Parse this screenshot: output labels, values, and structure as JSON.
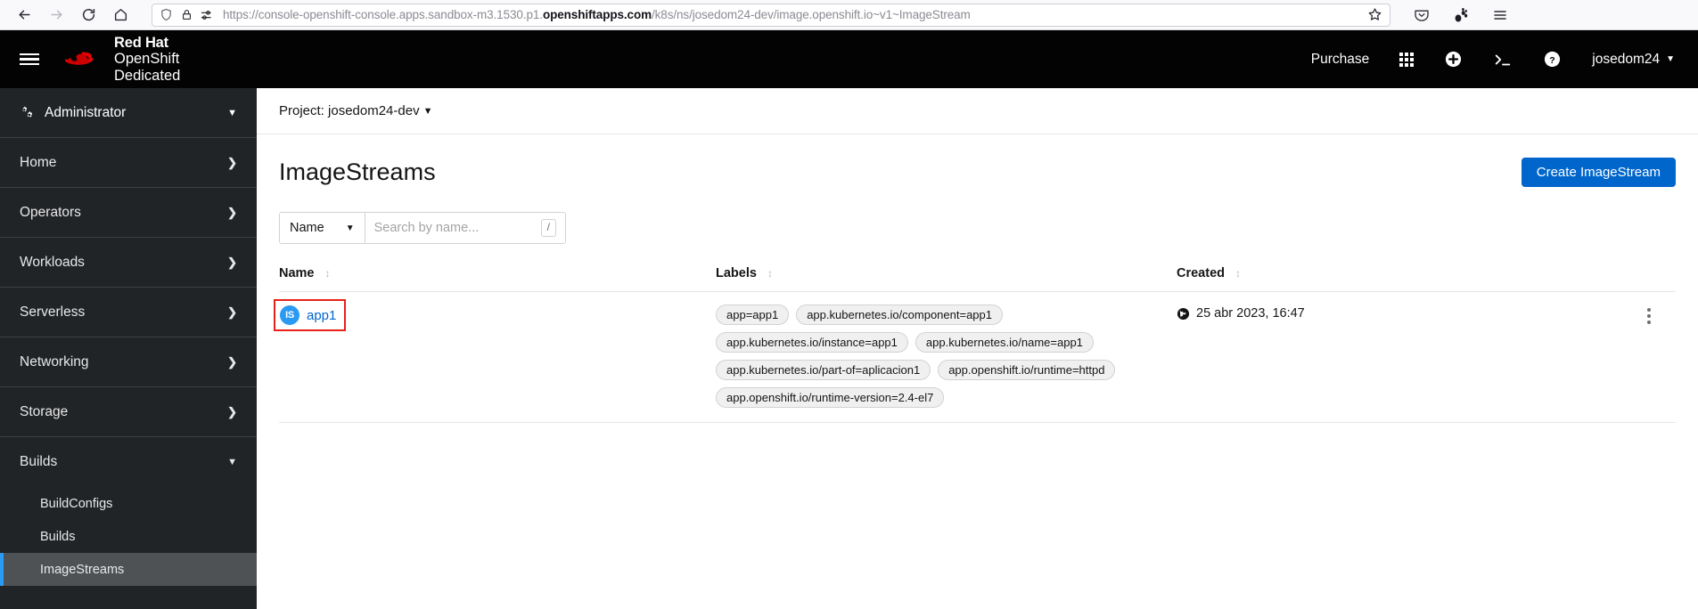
{
  "browser": {
    "back_icon": "back-arrow-icon",
    "forward_icon": "forward-arrow-icon",
    "reload_icon": "reload-icon",
    "home_icon": "home-icon",
    "shield_icon": "shield-icon",
    "lock_icon": "lock-icon",
    "permissions_icon": "permissions-icon",
    "url_prefix": "https://console-openshift-console.apps.sandbox-m3.1530.p1.",
    "url_domain": "openshiftapps.com",
    "url_suffix": "/k8s/ns/josedom24-dev/image.openshift.io~v1~ImageStream",
    "bookmark_icon": "star-icon",
    "pocket_icon": "pocket-icon",
    "extension_icon": "extension-icon",
    "menu_icon": "hamburger-menu-icon"
  },
  "masthead": {
    "nav_toggle": "hamburger-nav-toggle",
    "brand_line1": "Red Hat",
    "brand_line2": "OpenShift",
    "brand_line3": "Dedicated",
    "purchase_label": "Purchase",
    "apps_icon": "grid-apps-icon",
    "plus_icon": "plus-circle-icon",
    "terminal_icon": "terminal-icon",
    "help_icon": "help-circle-icon",
    "username": "josedom24"
  },
  "sidebar": {
    "perspective": {
      "icon": "gears-icon",
      "label": "Administrator",
      "caret": "▼"
    },
    "items": [
      {
        "label": "Home",
        "expandable": true
      },
      {
        "label": "Operators",
        "expandable": true
      },
      {
        "label": "Workloads",
        "expandable": true
      },
      {
        "label": "Serverless",
        "expandable": true
      },
      {
        "label": "Networking",
        "expandable": true
      },
      {
        "label": "Storage",
        "expandable": true
      },
      {
        "label": "Builds",
        "expandable": true,
        "expanded": true
      }
    ],
    "builds_children": [
      {
        "label": "BuildConfigs",
        "active": false
      },
      {
        "label": "Builds",
        "active": false
      },
      {
        "label": "ImageStreams",
        "active": true
      }
    ]
  },
  "project_bar": {
    "label": "Project: josedom24-dev",
    "caret": "▼"
  },
  "page": {
    "title": "ImageStreams",
    "create_button": "Create ImageStream"
  },
  "toolbar": {
    "filter_type": "Name",
    "filter_caret": "▼",
    "search_placeholder": "Search by name...",
    "search_value": "",
    "shortcut_badge": "/"
  },
  "table": {
    "columns": [
      {
        "label": "Name",
        "sortable": true
      },
      {
        "label": "Labels",
        "sortable": true
      },
      {
        "label": "Created",
        "sortable": true
      }
    ],
    "rows": [
      {
        "badge": "IS",
        "name": "app1",
        "highlighted": true,
        "labels": [
          "app=app1",
          "app.kubernetes.io/component=app1",
          "app.kubernetes.io/instance=app1",
          "app.kubernetes.io/name=app1",
          "app.kubernetes.io/part-of=aplicacion1",
          "app.openshift.io/runtime=httpd",
          "app.openshift.io/runtime-version=2.4-el7"
        ],
        "created": "25 abr 2023, 16:47",
        "created_icon": "globe-icon",
        "kebab": "kebab-menu-icon"
      }
    ]
  },
  "colors": {
    "accent_blue": "#0066cc",
    "highlight_red": "#e8211a",
    "masthead_black": "#030303",
    "sidebar_dark": "#212427",
    "active_nav": "#2b9af3"
  }
}
